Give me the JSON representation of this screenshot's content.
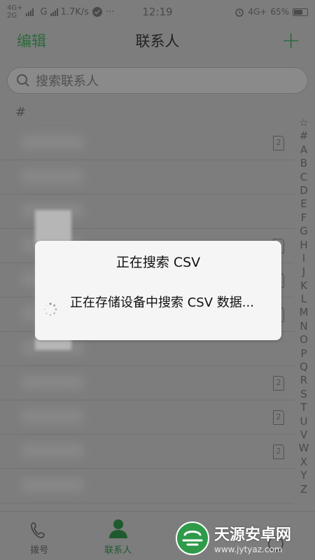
{
  "status_bar": {
    "net1": "4G+",
    "net2": "2G",
    "net3": "G",
    "speed": "1.7K/s",
    "time": "12:19",
    "net_right": "4G+",
    "battery_text": "65%"
  },
  "nav": {
    "edit_label": "编辑",
    "title": "联系人",
    "add_label": "+"
  },
  "search": {
    "placeholder": "搜索联系人"
  },
  "section_header": "#",
  "contacts": [
    {
      "sim_label": "2"
    },
    {
      "sim_label": ""
    },
    {
      "sim_label": ""
    },
    {
      "sim_label": "2"
    },
    {
      "sim_label": "2"
    },
    {
      "sim_label": "2"
    },
    {
      "sim_label": ""
    },
    {
      "sim_label": "2"
    },
    {
      "sim_label": "2"
    },
    {
      "sim_label": "2"
    },
    {
      "sim_label": ""
    }
  ],
  "alphabet": [
    "☆",
    "#",
    "A",
    "B",
    "C",
    "D",
    "E",
    "F",
    "G",
    "H",
    "I",
    "J",
    "K",
    "L",
    "M",
    "N",
    "O",
    "P",
    "Q",
    "R",
    "S",
    "T",
    "U",
    "V",
    "W",
    "X",
    "Y",
    "Z"
  ],
  "tabs": [
    {
      "label": "拨号",
      "icon": "dial-icon"
    },
    {
      "label": "联系人",
      "icon": "contact-person-icon"
    },
    {
      "label": "",
      "icon": ""
    },
    {
      "label": "",
      "icon": ""
    }
  ],
  "dialog": {
    "title": "正在搜索 CSV",
    "message": "正在存储设备中搜索 CSV 数据..."
  },
  "watermark": {
    "name": "天源安卓网",
    "url": "www.jytyaz.com"
  },
  "colors": {
    "accent": "#2b6b3c",
    "dialog_bg": "#f5f5f5",
    "scrim": "#7d7d7d"
  }
}
